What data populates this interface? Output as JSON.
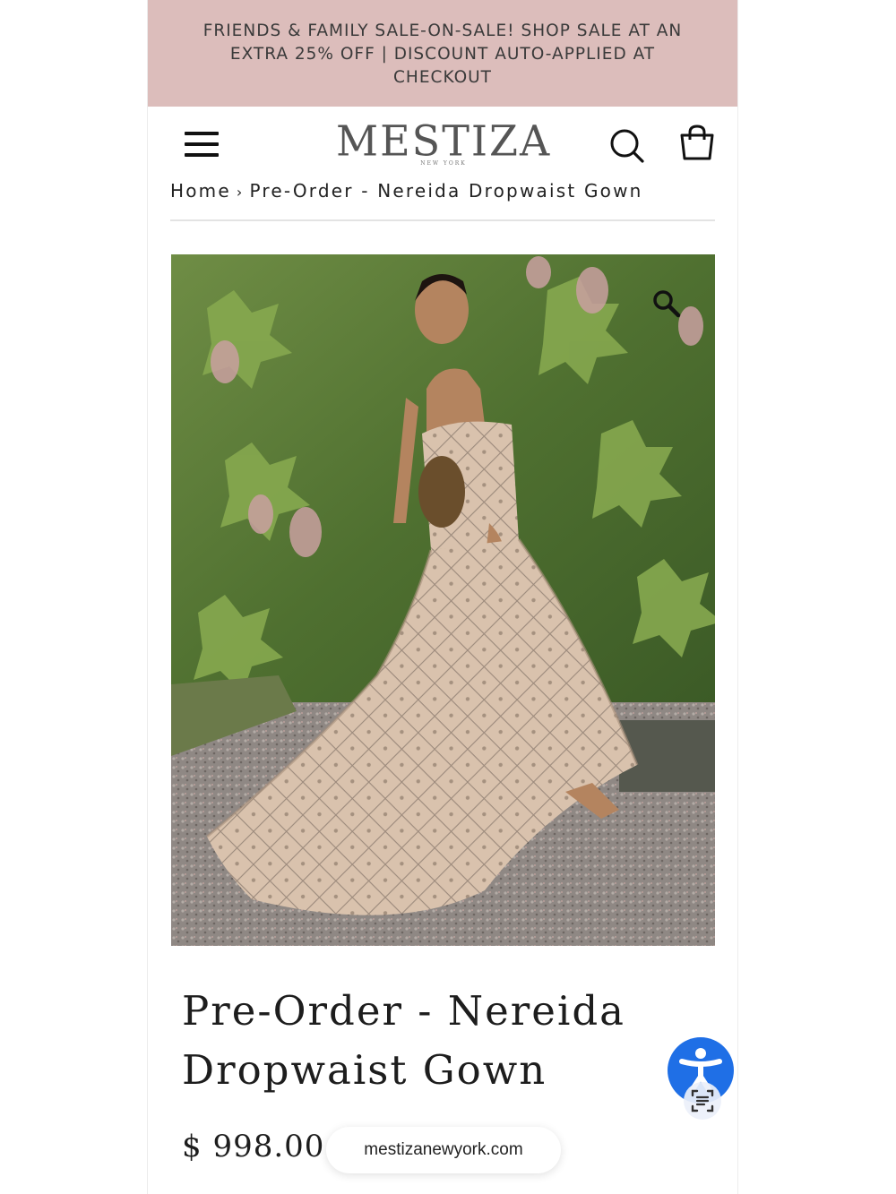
{
  "promo": {
    "text": "FRIENDS & FAMILY SALE-ON-SALE! SHOP SALE AT AN EXTRA 25% OFF | DISCOUNT AUTO-APPLIED AT CHECKOUT",
    "background": "#dcbdbb"
  },
  "header": {
    "logo": "MESTIZA",
    "logo_sub": "NEW YORK",
    "menu_icon": "hamburger-menu-icon",
    "search_icon": "search-icon",
    "bag_icon": "shopping-bag-icon"
  },
  "breadcrumb": {
    "home": "Home",
    "separator": "›",
    "current": "Pre-Order - Nereida Dropwaist Gown"
  },
  "product": {
    "image_zoom_icon": "magnifier-icon",
    "title": "Pre-Order - Nereida Dropwaist Gown",
    "price": "$ 998.00"
  },
  "browser": {
    "url": "mestizanewyork.com"
  },
  "widgets": {
    "accessibility_icon": "accessibility-person-icon",
    "accessibility_color": "#1f6fe6",
    "scan_icon": "text-scan-icon"
  }
}
